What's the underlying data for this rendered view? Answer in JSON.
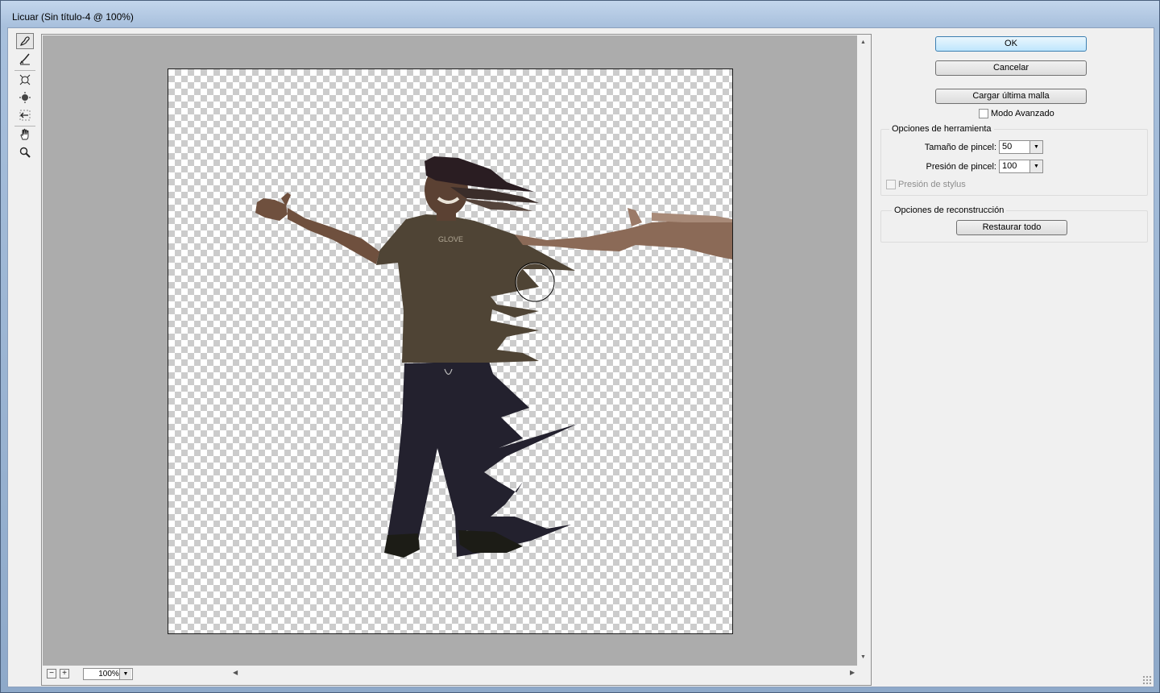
{
  "window": {
    "title": "Licuar (Sin título-4 @ 100%)"
  },
  "tools": [
    {
      "name": "forward-warp-icon",
      "active": true
    },
    {
      "name": "reconstruct-icon",
      "active": false
    },
    {
      "name": "pucker-icon",
      "active": false
    },
    {
      "name": "bloat-icon",
      "active": false
    },
    {
      "name": "push-left-icon",
      "active": false
    },
    {
      "name": "hand-icon",
      "active": false
    },
    {
      "name": "zoom-icon",
      "active": false
    }
  ],
  "preview": {
    "zoom": "100%"
  },
  "buttons": {
    "ok": "OK",
    "cancel": "Cancelar",
    "load_mesh": "Cargar última malla",
    "restore_all": "Restaurar todo"
  },
  "advanced_mode": {
    "label": "Modo Avanzado",
    "checked": false
  },
  "tool_options": {
    "title": "Opciones de herramienta",
    "brush_size": {
      "label": "Tamaño de pincel:",
      "value": "50"
    },
    "brush_pressure": {
      "label": "Presión de pincel:",
      "value": "100"
    },
    "stylus_pressure": {
      "label": "Presión de stylus",
      "checked": false,
      "enabled": false
    }
  },
  "reconstruct_options": {
    "title": "Opciones de reconstrucción"
  },
  "colors": {
    "accent": "#3c7fb1",
    "preview_bg": "#acacac",
    "shirt": "#4f4435",
    "pants": "#23212e",
    "skin": "#8b6a57"
  }
}
